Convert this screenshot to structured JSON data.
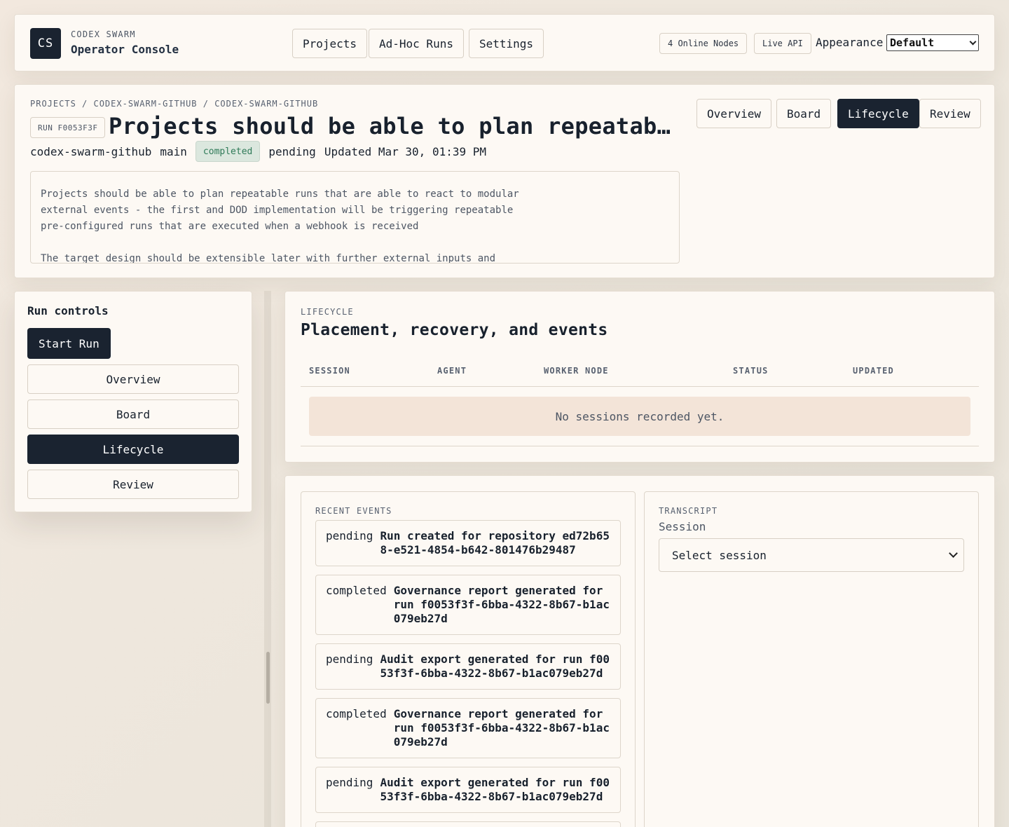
{
  "topbar": {
    "logo_initials": "CS",
    "brand_kicker": "CODEX SWARM",
    "brand_title": "Operator Console",
    "nav": [
      "Projects",
      "Ad-Hoc Runs",
      "Settings"
    ],
    "online_nodes": "4 Online Nodes",
    "live_api": "Live API",
    "appearance_label": "Appearance",
    "appearance_value": "Default"
  },
  "header": {
    "breadcrumb": "PROJECTS / CODEX-SWARM-GITHUB / CODEX-SWARM-GITHUB",
    "run_tag": "RUN F0053F3F",
    "title": "Projects should be able to plan repeatable runs that are able to react to modular external events",
    "repo": "codex-swarm-github",
    "branch": "main",
    "status_badge": "completed",
    "state": "pending",
    "updated": "Updated Mar 30, 01:39 PM",
    "description": "Projects should be able to plan repeatable runs that are able to react to modular\nexternal events - the first and DOD implementation will be triggering repeatable\npre-configured runs that are executed when a webhook is received\n\nThe target design should be extensible later with further external inputs and",
    "tabs": [
      "Overview",
      "Board",
      "Lifecycle",
      "Review"
    ],
    "active_tab": "Lifecycle"
  },
  "sidebar": {
    "title": "Run controls",
    "start_button": "Start Run",
    "items": [
      "Overview",
      "Board",
      "Lifecycle",
      "Review"
    ],
    "active_item": "Lifecycle"
  },
  "lifecycle": {
    "kicker": "LIFECYCLE",
    "title": "Placement, recovery, and events",
    "columns": [
      "SESSION",
      "AGENT",
      "WORKER NODE",
      "STATUS",
      "UPDATED"
    ],
    "empty_message": "No sessions recorded yet."
  },
  "events": {
    "kicker": "RECENT EVENTS",
    "items": [
      {
        "status": "pending",
        "text": "Run created for repository ed72b658-e521-4854-b642-801476b29487"
      },
      {
        "status": "completed",
        "text": "Governance report generated for run f0053f3f-6bba-4322-8b67-b1ac079eb27d"
      },
      {
        "status": "pending",
        "text": "Audit export generated for run f0053f3f-6bba-4322-8b67-b1ac079eb27d"
      },
      {
        "status": "completed",
        "text": "Governance report generated for run f0053f3f-6bba-4322-8b67-b1ac079eb27d"
      },
      {
        "status": "pending",
        "text": "Audit export generated for run f0053f3f-6bba-4322-8b67-b1ac079eb27d"
      }
    ]
  },
  "transcript": {
    "kicker": "TRANSCRIPT",
    "session_label": "Session",
    "select_placeholder": "Select session"
  }
}
